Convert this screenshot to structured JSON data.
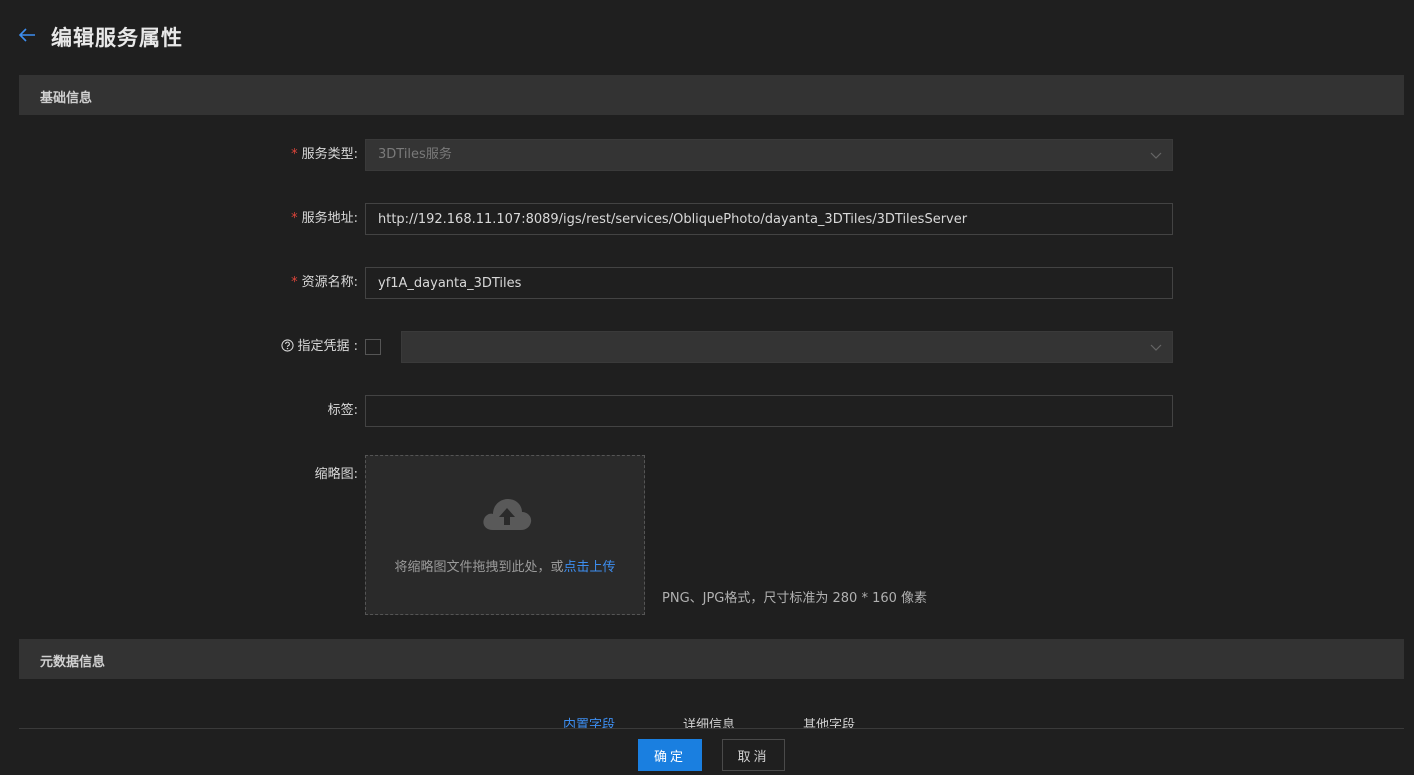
{
  "header": {
    "title": "编辑服务属性",
    "back_icon": "arrow-left-icon"
  },
  "sections": {
    "basic": "基础信息",
    "metadata": "元数据信息"
  },
  "form": {
    "service_type": {
      "label": "服务类型:",
      "value": "3DTiles服务"
    },
    "service_url": {
      "label": "服务地址:",
      "value": "http://192.168.11.107:8089/igs/rest/services/ObliquePhoto/dayanta_3DTiles/3DTilesServer"
    },
    "resource_name": {
      "label": "资源名称:",
      "value": "yf1A_dayanta_3DTiles"
    },
    "credential": {
      "label": "指定凭据 :",
      "checked": false,
      "value": ""
    },
    "tags": {
      "label": "标签:",
      "value": ""
    },
    "thumbnail": {
      "label": "缩略图:",
      "upload_text": "将缩略图文件拖拽到此处，或",
      "upload_link": "点击上传",
      "hint": "PNG、JPG格式，尺寸标准为 280 * 160 像素"
    }
  },
  "tabs": [
    {
      "label": "内置字段",
      "active": true
    },
    {
      "label": "详细信息",
      "active": false
    },
    {
      "label": "其他字段",
      "active": false
    }
  ],
  "footer": {
    "ok_label": "确定",
    "cancel_label": "取消"
  },
  "colors": {
    "accent": "#1a7fe0",
    "link": "#3d8ef0",
    "required": "#e0453b",
    "background": "#1f1f1f"
  }
}
